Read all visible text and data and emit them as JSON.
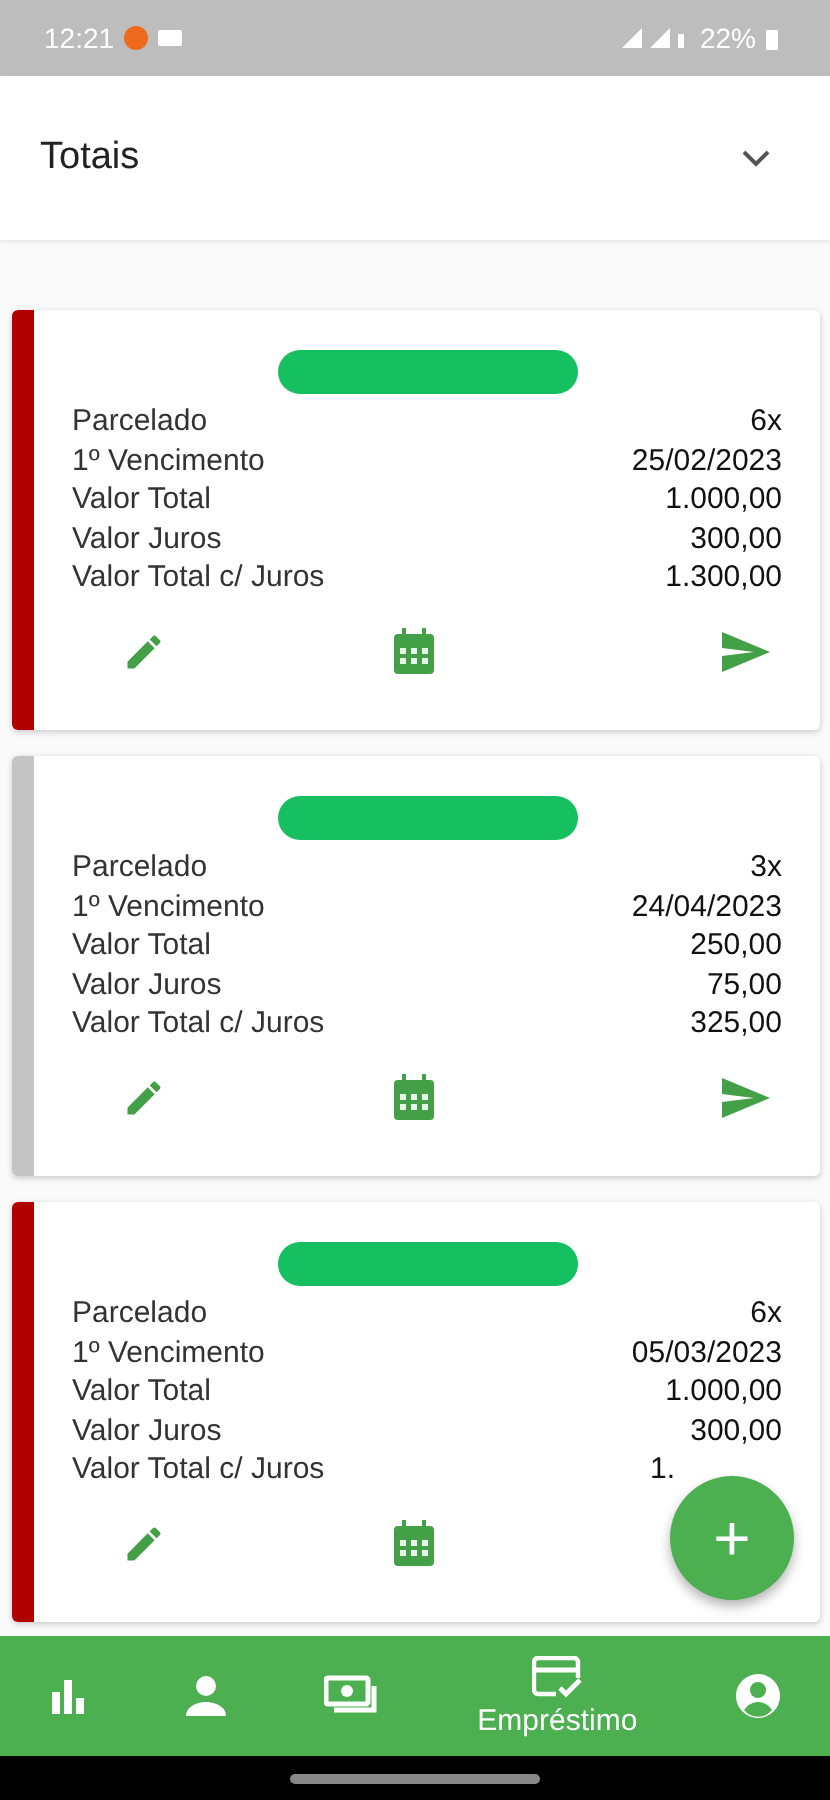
{
  "status_bar": {
    "time": "12:21",
    "battery": "22%"
  },
  "header": {
    "title": "Totais"
  },
  "cards": [
    {
      "color": "#b00000",
      "rows": [
        {
          "label": "Parcelado",
          "value": "6x"
        },
        {
          "label": "1º Vencimento",
          "value": "25/02/2023"
        },
        {
          "label": "Valor Total",
          "value": "1.000,00"
        },
        {
          "label": "Valor Juros",
          "value": "300,00"
        },
        {
          "label": "Valor Total c/ Juros",
          "value": "1.300,00"
        }
      ],
      "actions": [
        {
          "kind": "edit"
        },
        {
          "kind": "calendar"
        },
        {
          "kind": "send"
        }
      ]
    },
    {
      "color": "#c4c4c4",
      "rows": [
        {
          "label": "Parcelado",
          "value": "3x"
        },
        {
          "label": "1º Vencimento",
          "value": "24/04/2023"
        },
        {
          "label": "Valor Total",
          "value": "250,00"
        },
        {
          "label": "Valor Juros",
          "value": "75,00"
        },
        {
          "label": "Valor Total c/ Juros",
          "value": "325,00"
        }
      ],
      "actions": [
        {
          "kind": "edit"
        },
        {
          "kind": "calendar"
        },
        {
          "kind": "send"
        }
      ]
    },
    {
      "color": "#b00000",
      "rows": [
        {
          "label": "Parcelado",
          "value": "6x"
        },
        {
          "label": "1º Vencimento",
          "value": "05/03/2023"
        },
        {
          "label": "Valor Total",
          "value": "1.000,00"
        },
        {
          "label": "Valor Juros",
          "value": "300,00"
        },
        {
          "label": "Valor Total c/ Juros",
          "value": "1.",
          "covered": true
        }
      ],
      "actions": [
        {
          "kind": "edit"
        },
        {
          "kind": "calendar"
        }
      ]
    }
  ],
  "fab": {
    "label": "+"
  },
  "nav": [
    {
      "kind": "chart",
      "selected": false
    },
    {
      "kind": "person",
      "selected": false
    },
    {
      "kind": "money",
      "selected": false
    },
    {
      "kind": "loan",
      "selected": true,
      "label": "Empréstimo"
    },
    {
      "kind": "account",
      "selected": false
    }
  ]
}
